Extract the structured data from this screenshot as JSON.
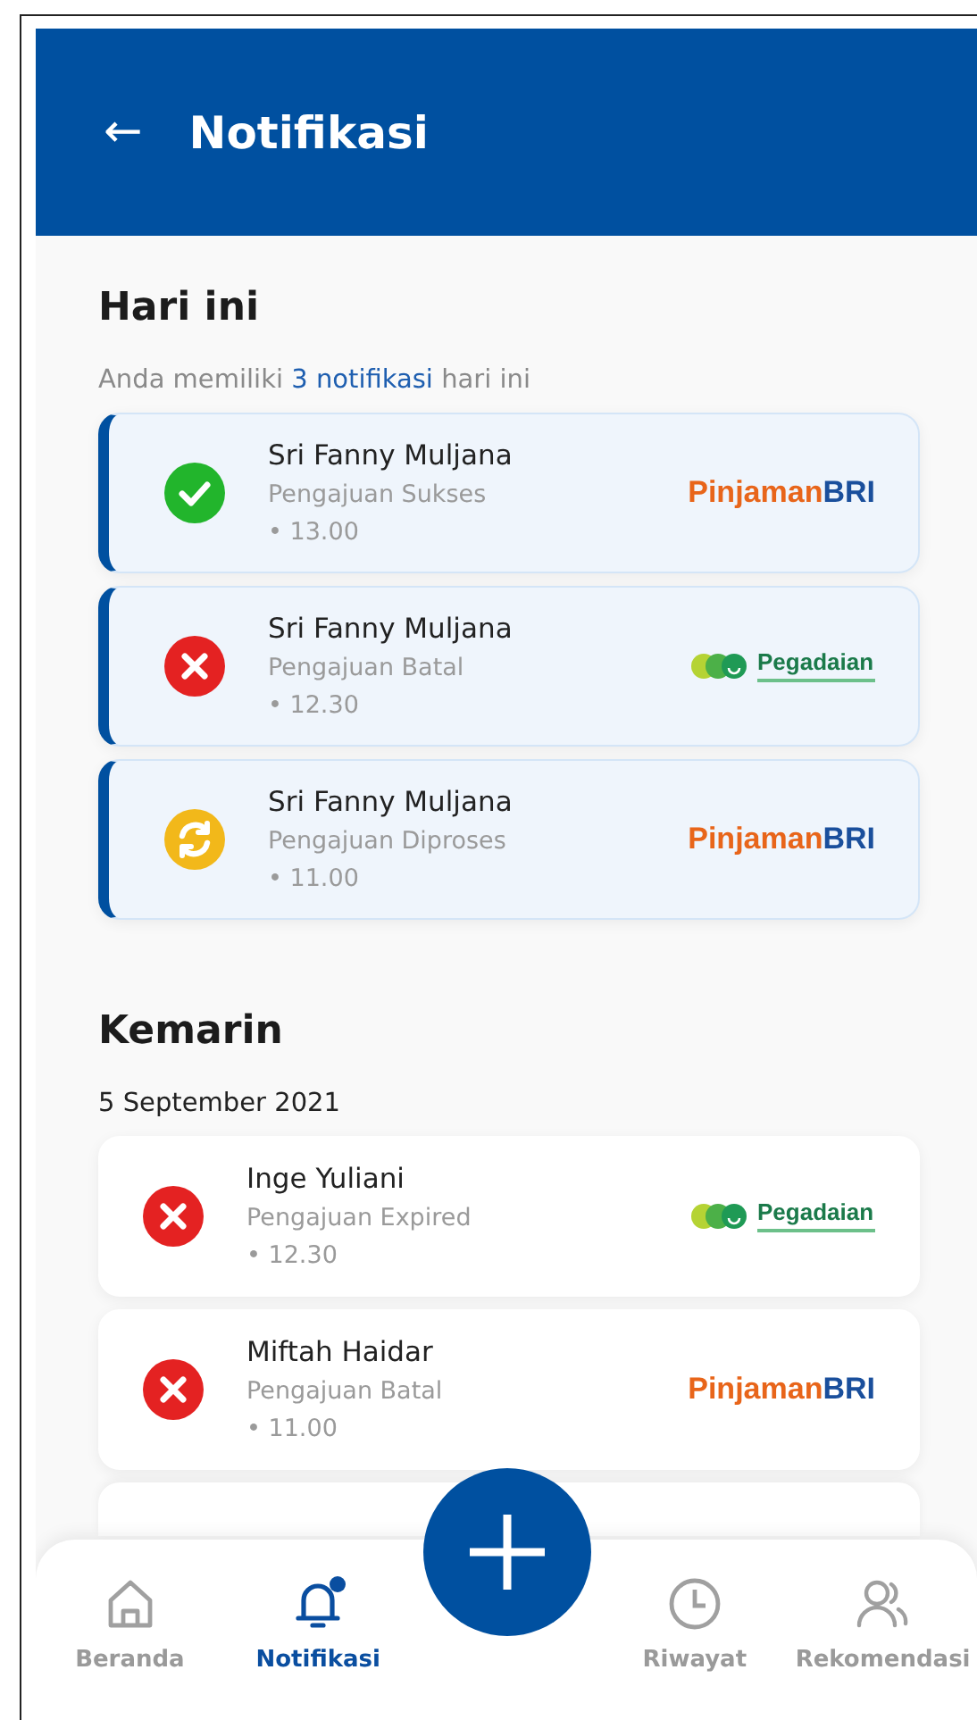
{
  "header": {
    "back_icon": "←",
    "title": "Notifikasi"
  },
  "sections": [
    {
      "title": "Hari ini",
      "subtitle": "Anda memiliki **3 notifikasi** hari ini",
      "items": [
        {
          "name": "Sri Fanny Muljana",
          "status_text": "Pengajuan Sukses",
          "time": "• 13.00",
          "kind": "success",
          "unread": true,
          "brand": {
            "kind": "bri",
            "part_1": "Pinjaman",
            "part_2": "BRI"
          }
        },
        {
          "name": "Sri Fanny Muljana",
          "status_text": "Pengajuan Batal",
          "time": "• 12.30",
          "kind": "failed",
          "unread": true,
          "brand": {
            "kind": "pegadaian",
            "part_1": "Pegadaian"
          }
        },
        {
          "name": "Sri Fanny Muljana",
          "status_text": "Pengajuan Diproses",
          "time": "• 11.00",
          "kind": "process",
          "unread": true,
          "brand": {
            "kind": "bri",
            "part_1": "Pinjaman",
            "part_2": "BRI"
          }
        }
      ]
    },
    {
      "title": "Kemarin",
      "subtitle": "5 September 2021",
      "items": [
        {
          "name": "Inge Yuliani",
          "status_text": "Pengajuan Expired",
          "time": "• 12.30",
          "kind": "failed",
          "unread": false,
          "brand": {
            "kind": "pegadaian",
            "part_1": "Pegadaian"
          }
        },
        {
          "name": "Miftah Haidar",
          "status_text": "Pengajuan Batal",
          "time": "• 11.00",
          "kind": "failed",
          "unread": false,
          "brand": {
            "kind": "bri",
            "part_1": "Pinjaman",
            "part_2": "BRI"
          }
        }
      ]
    }
  ],
  "nav": [
    {
      "label": "Beranda",
      "kind": "home",
      "selected": false,
      "badge": false
    },
    {
      "label": "Notifikasi",
      "kind": "bell",
      "selected": true,
      "badge": true
    },
    {
      "kind": "fab"
    },
    {
      "label": "Riwayat",
      "kind": "clock",
      "selected": false,
      "badge": false
    },
    {
      "label": "Rekomendasi",
      "kind": "people",
      "selected": false,
      "badge": false
    }
  ]
}
